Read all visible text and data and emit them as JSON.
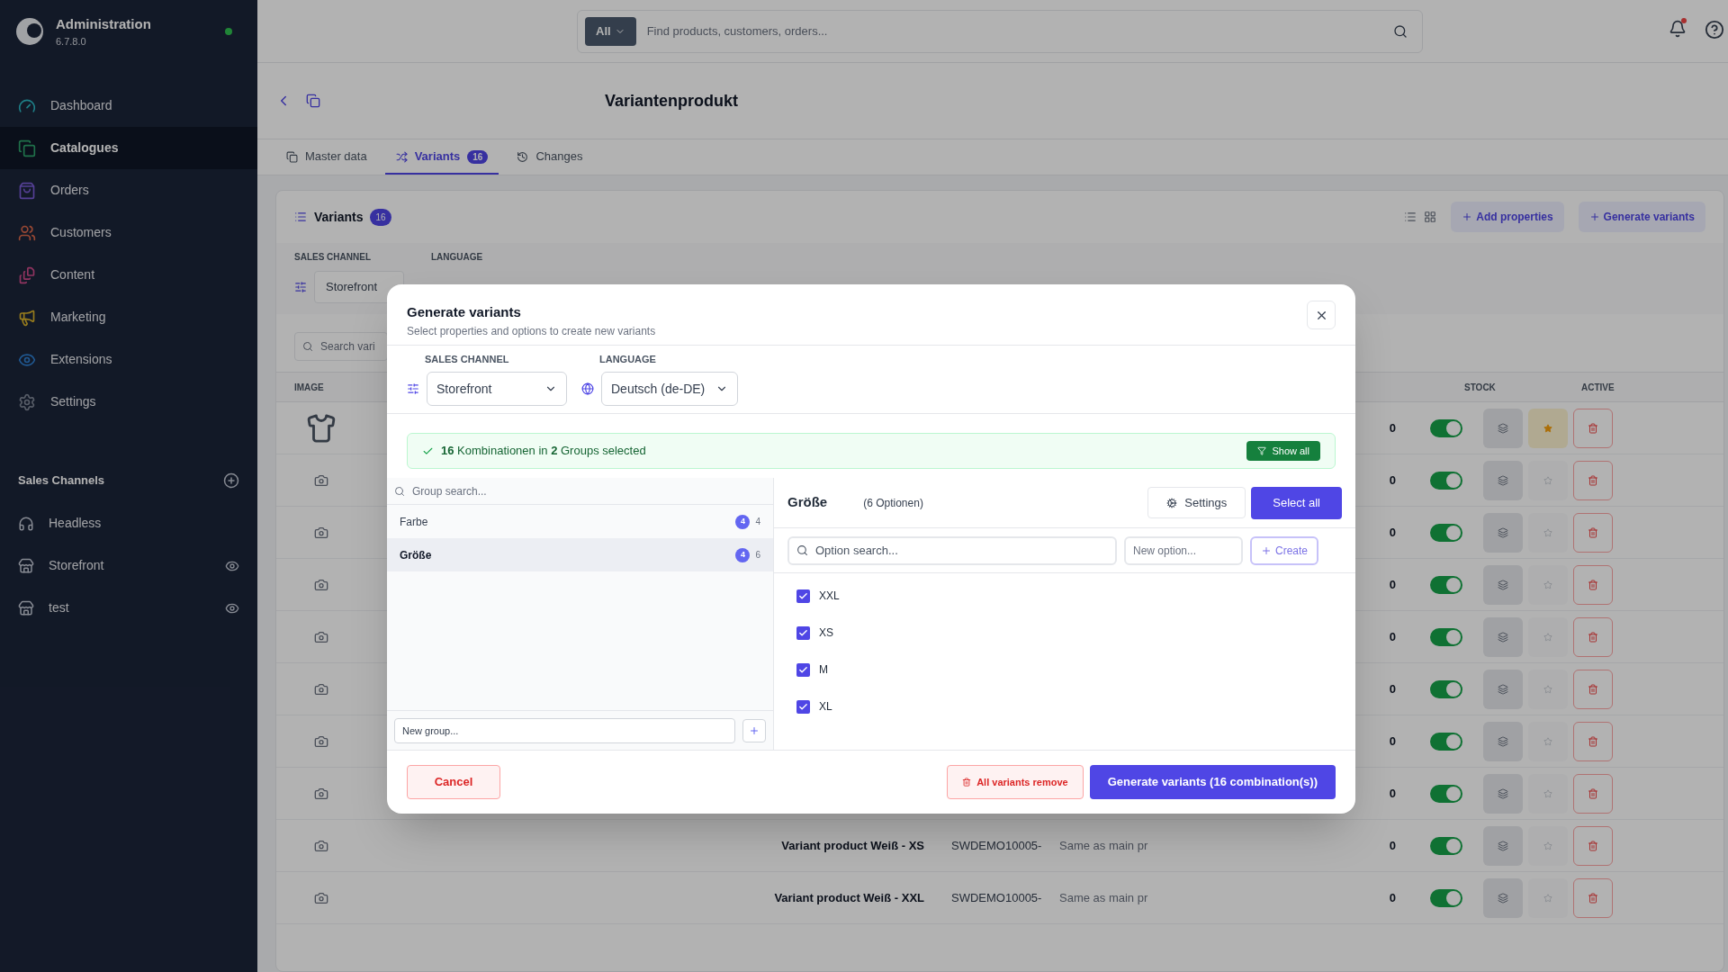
{
  "sidebar": {
    "title": "Administration",
    "version": "6.7.8.0",
    "online": true,
    "items": [
      {
        "label": "Dashboard",
        "selected": false
      },
      {
        "label": "Catalogues",
        "selected": true
      },
      {
        "label": "Orders",
        "selected": false
      },
      {
        "label": "Customers",
        "selected": false
      },
      {
        "label": "Content",
        "selected": false
      },
      {
        "label": "Marketing",
        "selected": false
      },
      {
        "label": "Extensions",
        "selected": false
      },
      {
        "label": "Settings",
        "selected": false
      }
    ],
    "channels_title": "Sales Channels",
    "channels": [
      {
        "label": "Headless",
        "visible": false
      },
      {
        "label": "Storefront",
        "visible": true
      },
      {
        "label": "test",
        "visible": true
      }
    ]
  },
  "search": {
    "scope": "All",
    "placeholder": "Find products, customers, orders..."
  },
  "notifications": {
    "unread": true
  },
  "page": {
    "title": "Variantenprodukt",
    "tabs": [
      {
        "label": "Master data",
        "selected": false
      },
      {
        "label": "Variants",
        "badge": "16",
        "selected": true
      },
      {
        "label": "Changes",
        "selected": false
      }
    ],
    "card_title": "Variants",
    "card_badge": "16",
    "actions": [
      "Add properties",
      "Generate variants"
    ],
    "filter_labels": [
      "SALES CHANNEL",
      "LANGUAGE"
    ],
    "filter_value": "Storefront",
    "search_placeholder": "Search vari",
    "columns": [
      "IMAGE",
      "STOCK",
      "ACTIVE"
    ],
    "rows": [
      {
        "has_image": true,
        "stock": "0",
        "active": true,
        "main": true
      },
      {
        "has_image": false,
        "stock": "0",
        "active": true,
        "main": false
      },
      {
        "has_image": false,
        "stock": "0",
        "active": true,
        "main": false
      },
      {
        "has_image": false,
        "stock": "0",
        "active": true,
        "main": false
      },
      {
        "has_image": false,
        "stock": "0",
        "active": true,
        "main": false
      },
      {
        "has_image": false,
        "stock": "0",
        "active": true,
        "main": false
      },
      {
        "has_image": false,
        "stock": "0",
        "active": true,
        "main": false
      },
      {
        "has_image": false,
        "stock": "0",
        "active": true,
        "main": false
      },
      {
        "has_image": false,
        "name": "Variant product Weiß - XS",
        "sku": "SWDEMO10005-",
        "description": "Same as main pr",
        "stock": "0",
        "active": true,
        "main": false
      },
      {
        "has_image": false,
        "name": "Variant product Weiß - XXL",
        "sku": "SWDEMO10005-",
        "description": "Same as main pr",
        "stock": "0",
        "active": true,
        "main": false
      }
    ]
  },
  "dialog": {
    "title": "Generate variants",
    "subtitle": "Select properties and options to create new variants",
    "sales_channel": {
      "label": "SALES CHANNEL",
      "value": "Storefront"
    },
    "language": {
      "label": "LANGUAGE",
      "value": "Deutsch (de-DE)"
    },
    "summary": "**16** Kombinationen in **2** Groups selected",
    "show_all": "Show all",
    "group_search_placeholder": "Group search...",
    "groups": [
      {
        "name": "Farbe",
        "selected_count": "4",
        "total": "4",
        "selected": false
      },
      {
        "name": "Größe",
        "selected_count": "4",
        "total": "6",
        "selected": true
      }
    ],
    "new_group_placeholder": "New group...",
    "group_title": "Größe",
    "group_count": "(6 Optionen)",
    "settings": "Settings",
    "select_all": "Select all",
    "option_search_placeholder": "Option search...",
    "new_option_placeholder": "New option...",
    "create": "Create",
    "options": [
      {
        "label": "XXL",
        "checked": true
      },
      {
        "label": "XS",
        "checked": true
      },
      {
        "label": "M",
        "checked": true
      },
      {
        "label": "XL",
        "checked": true
      }
    ],
    "cancel": "Cancel",
    "remove_all": "All variants remove",
    "generate": "Generate variants (16 combination(s))"
  }
}
